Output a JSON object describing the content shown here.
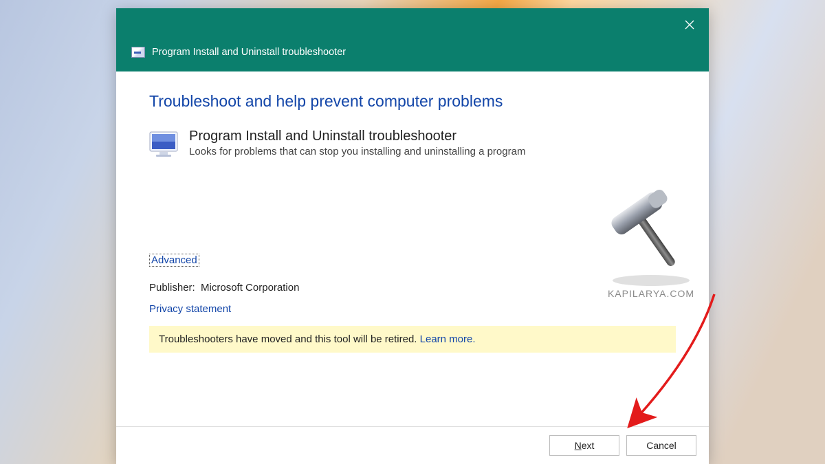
{
  "titlebar": {
    "title": "Program Install and Uninstall troubleshooter"
  },
  "heading": "Troubleshoot and help prevent computer problems",
  "program": {
    "title": "Program Install and Uninstall troubleshooter",
    "desc": "Looks for problems that can stop you installing and uninstalling a program"
  },
  "advanced": "Advanced",
  "publisher_label": "Publisher:",
  "publisher_name": "Microsoft Corporation",
  "privacy": "Privacy statement",
  "notice": {
    "text": "Troubleshooters have moved and this tool will be retired. ",
    "learn": "Learn more."
  },
  "buttons": {
    "next": "Next",
    "cancel": "Cancel"
  },
  "watermark": "KAPILARYA.COM"
}
